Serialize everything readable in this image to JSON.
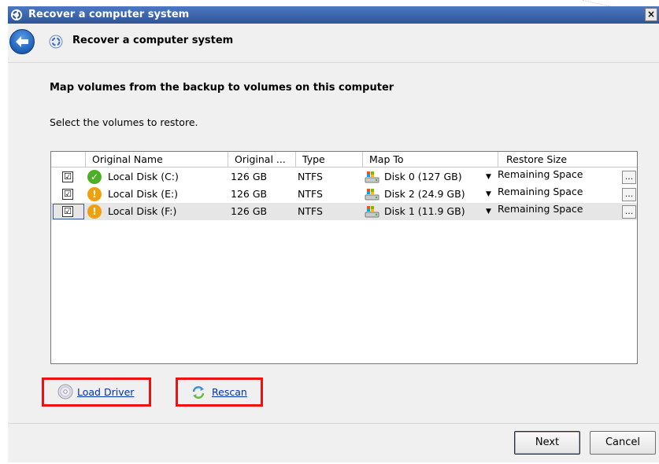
{
  "window": {
    "title": "Recover a computer system",
    "close_glyph": "×"
  },
  "header": {
    "title": "Recover a computer system"
  },
  "content": {
    "heading": "Map volumes from the backup to volumes on this computer",
    "subtext": "Select the volumes to restore."
  },
  "grid": {
    "columns": [
      "Original Name",
      "Original ...",
      "Type",
      "Map To",
      "Restore Size"
    ],
    "rows": [
      {
        "checked": "☑",
        "status": "ok",
        "name": "Local Disk (C:)",
        "size": "126 GB",
        "type": "NTFS",
        "map_to": "Disk 0 (127 GB)",
        "restore_size": "Remaining Space"
      },
      {
        "checked": "☑",
        "status": "warning",
        "name": "Local Disk (E:)",
        "size": "126 GB",
        "type": "NTFS",
        "map_to": "Disk 2 (24.9 GB)",
        "restore_size": "Remaining Space"
      },
      {
        "checked": "☑",
        "status": "warning",
        "name": "Local Disk (F:)",
        "size": "126 GB",
        "type": "NTFS",
        "map_to": "Disk 1 (11.9 GB)",
        "restore_size": "Remaining Space"
      }
    ],
    "ellipsis_label": "..."
  },
  "actions": {
    "load_driver": "Load Driver",
    "rescan": "Rescan"
  },
  "footer": {
    "next": "Next",
    "cancel": "Cancel"
  },
  "colors": {
    "titlebar": "#3c63a7",
    "highlight_box": "#ee1111",
    "link": "#0033aa",
    "status_ok": "#4caf28",
    "status_warning": "#f0a00c"
  },
  "icons": {
    "title": "recovery-icon",
    "back": "back-arrow-icon",
    "header": "recovery-wizard-icon",
    "status_ok": "check-circle-icon",
    "status_warning": "warning-circle-icon",
    "disk": "disk-drive-icon",
    "load_driver": "cd-icon",
    "rescan": "refresh-icon"
  }
}
